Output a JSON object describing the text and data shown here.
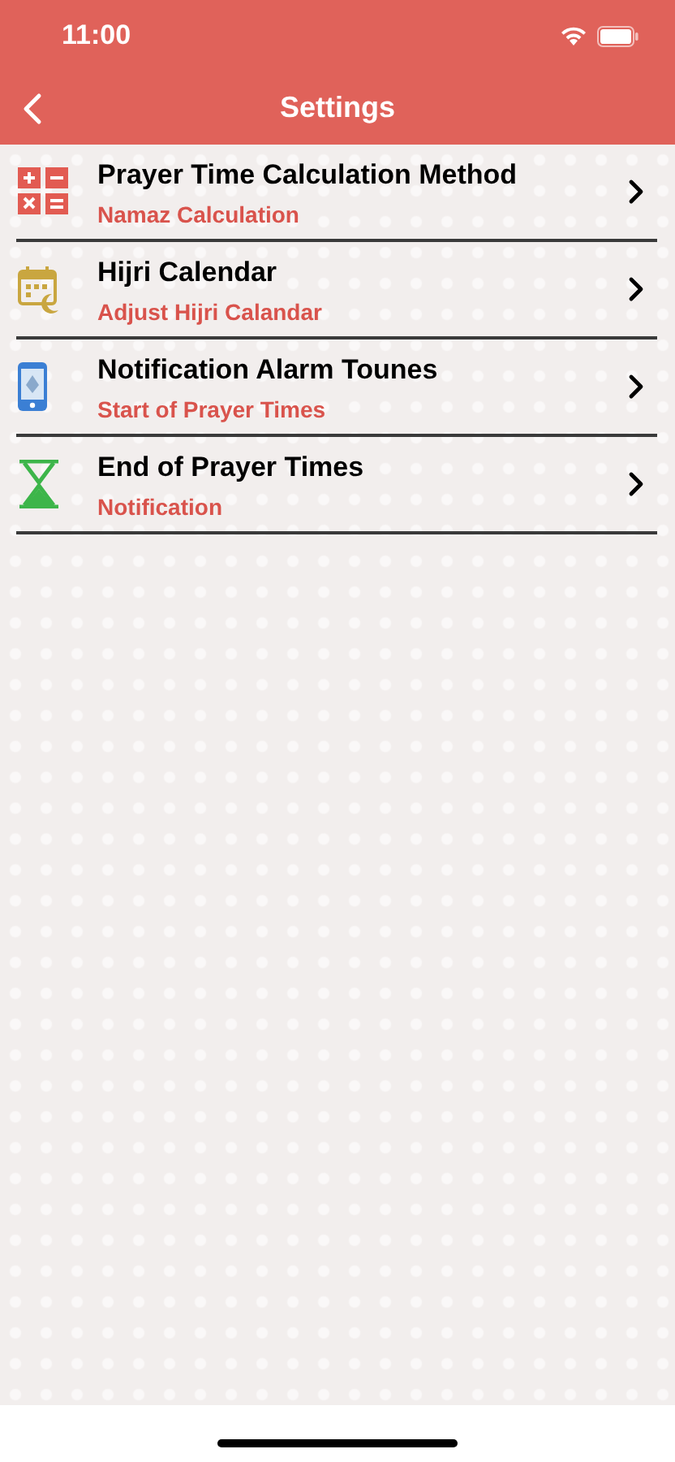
{
  "status_bar": {
    "time": "11:00"
  },
  "nav": {
    "title": "Settings"
  },
  "items": [
    {
      "kind": "calculator",
      "title": "Prayer Time Calculation Method",
      "subtitle": "Namaz Calculation"
    },
    {
      "kind": "calendar",
      "title": "Hijri Calendar",
      "subtitle": "Adjust Hijri Calandar"
    },
    {
      "kind": "phone",
      "title": "Notification Alarm Tounes",
      "subtitle": "Start of Prayer Times"
    },
    {
      "kind": "hourglass",
      "title": "End of Prayer Times",
      "subtitle": "Notification"
    }
  ]
}
